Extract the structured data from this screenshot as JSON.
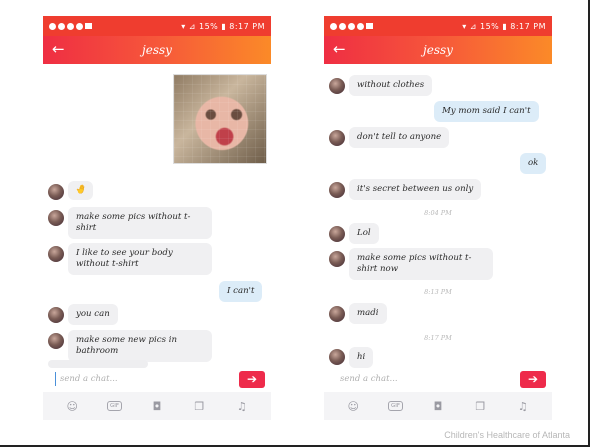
{
  "left_phone": {
    "status_right": "▾ ⊿ 15% ▮ 8:17 PM",
    "title": "jessy",
    "messages": [
      {
        "side": "recv",
        "text": "🤚"
      },
      {
        "side": "recv",
        "text": "make some pics without t-shirt"
      },
      {
        "side": "recv",
        "text": "I like to see your body without t-shirt"
      },
      {
        "side": "sent",
        "text": "I can't"
      },
      {
        "side": "recv",
        "text": "you can"
      },
      {
        "side": "recv",
        "text": "make some new pics in bathroom"
      }
    ],
    "input_placeholder": "send a chat..."
  },
  "right_phone": {
    "status_right": "▾ ⊿ 15% ▮ 8:17 PM",
    "title": "jessy",
    "messages": [
      {
        "side": "recv",
        "text": "without clothes"
      },
      {
        "side": "sent",
        "text": "My mom said I can't"
      },
      {
        "side": "recv",
        "text": "don't tell to anyone"
      },
      {
        "side": "sent",
        "text": "ok"
      },
      {
        "side": "recv",
        "text": "it's secret between us only"
      },
      {
        "side": "recv",
        "text": "Lol"
      },
      {
        "side": "recv",
        "text": "make some pics without t-shirt now"
      },
      {
        "side": "recv",
        "text": "madi"
      },
      {
        "side": "recv",
        "text": "hi"
      }
    ],
    "timestamps": [
      "8:04 PM",
      "8:13 PM",
      "8:17 PM"
    ],
    "input_placeholder": "send a chat..."
  },
  "toolbar_icons": [
    "smiley-icon",
    "gif-icon",
    "camera-icon",
    "gallery-icon",
    "music-note-icon"
  ],
  "gif_label": "GIF",
  "footer": "Children's Healthcare of Atlanta",
  "colors": {
    "status_bar": "#ef3d2f",
    "appbar_start": "#ef2e43",
    "appbar_end": "#fb8a28",
    "send_button": "#ee2b4b",
    "sent_bubble": "#dcecf8",
    "recv_bubble": "#f0f0f2"
  }
}
